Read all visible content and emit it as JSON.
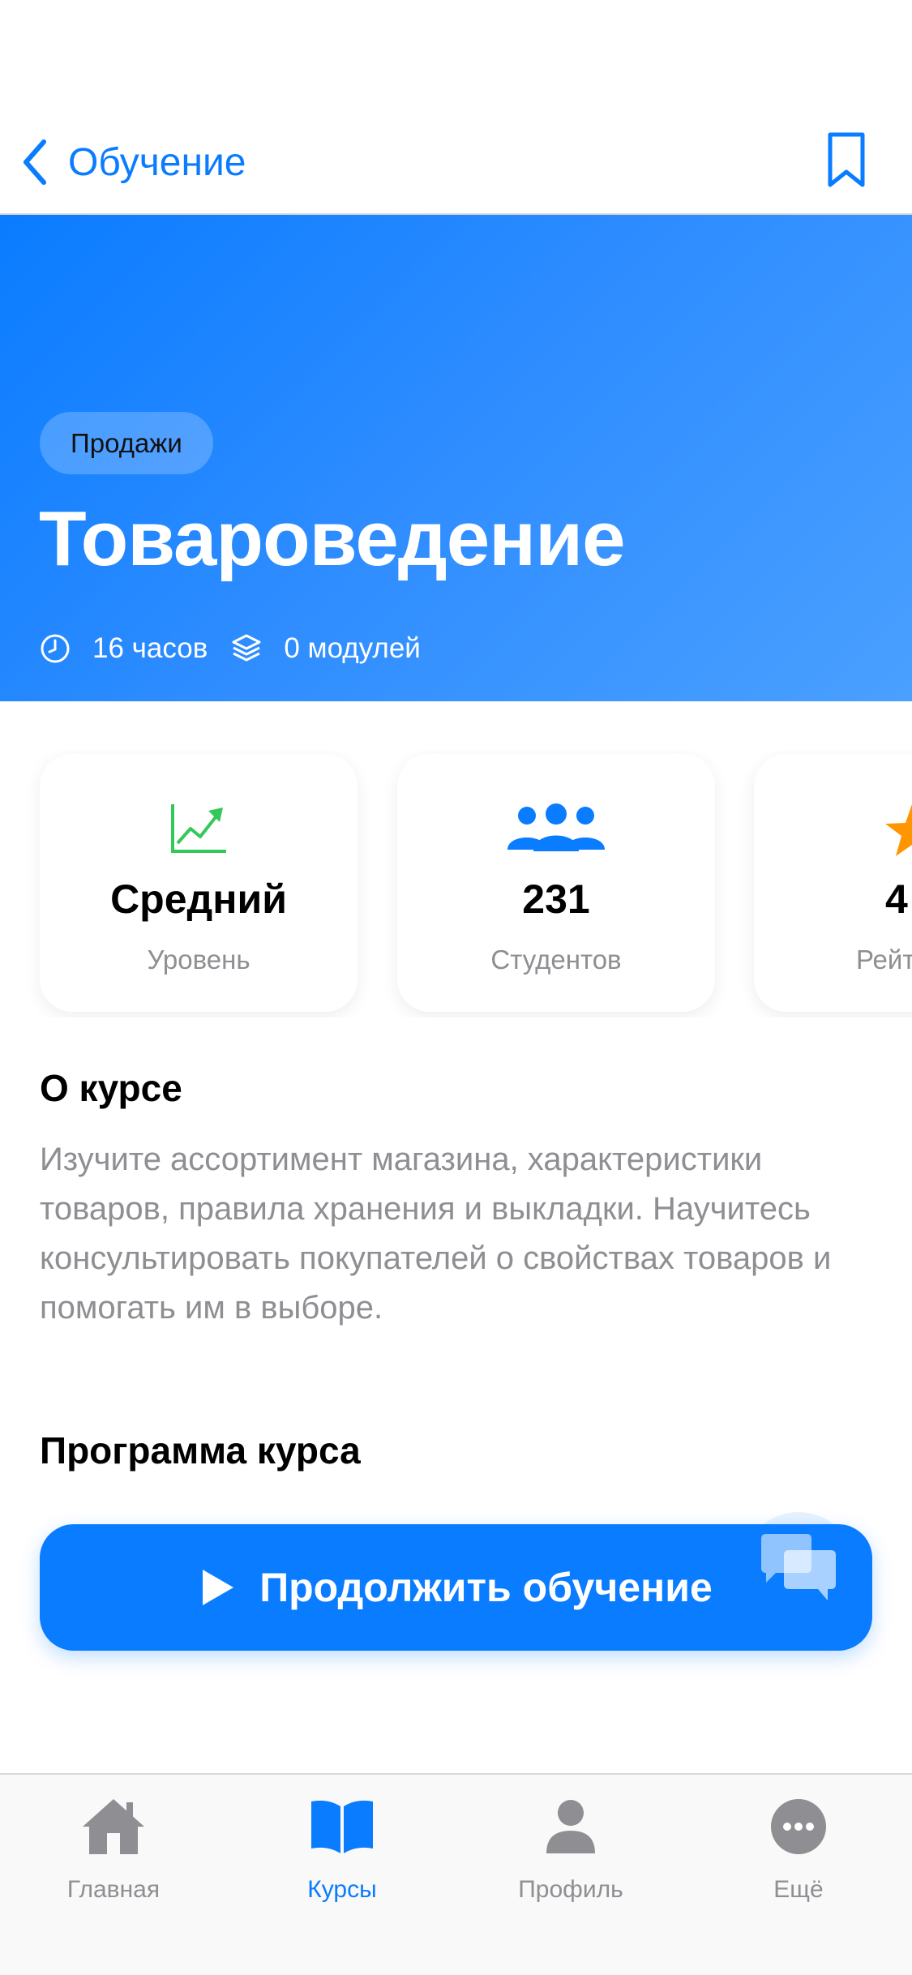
{
  "nav": {
    "back_label": "Обучение"
  },
  "hero": {
    "tag": "Продажи",
    "title": "Товароведение",
    "duration": "16 часов",
    "modules": "0 модулей"
  },
  "stats": [
    {
      "value": "Средний",
      "label": "Уровень",
      "icon": "chart-up-icon"
    },
    {
      "value": "231",
      "label": "Студентов",
      "icon": "people-icon"
    },
    {
      "value": "4",
      "label": "Рейт",
      "icon": "star-icon"
    }
  ],
  "about": {
    "title": "О курсе",
    "text": "Изучите ассортимент магазина, характеристики товаров, правила хранения и выкладки. Научитесь консультировать покупателей о свойствах товаров и помогать им в выборе."
  },
  "program": {
    "title": "Программа курса"
  },
  "cta": {
    "label": "Продолжить обучение"
  },
  "tabbar": {
    "items": [
      {
        "label": "Главная",
        "icon": "home-icon",
        "active": false
      },
      {
        "label": "Курсы",
        "icon": "book-icon",
        "active": true
      },
      {
        "label": "Профиль",
        "icon": "person-icon",
        "active": false
      },
      {
        "label": "Ещё",
        "icon": "more-icon",
        "active": false
      }
    ]
  },
  "colors": {
    "accent": "#0A7CFF",
    "success": "#34C759",
    "star": "#FF9500",
    "muted": "#8E8E93"
  }
}
